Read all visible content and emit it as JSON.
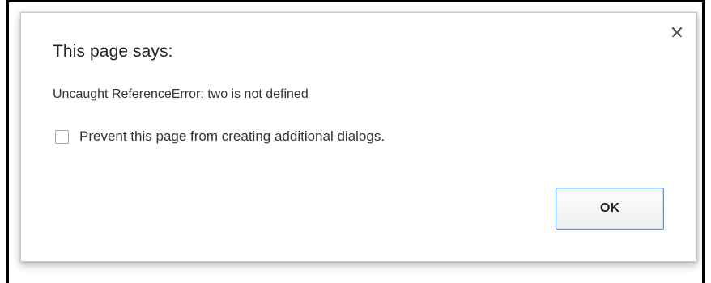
{
  "dialog": {
    "title": "This page says:",
    "message": "Uncaught ReferenceError: two is not defined",
    "checkbox": {
      "label": "Prevent this page from creating additional dialogs.",
      "checked": false
    },
    "ok_label": "OK",
    "close_icon": "close-icon"
  },
  "colors": {
    "ok_border": "#4d90fe",
    "text": "#333333"
  }
}
